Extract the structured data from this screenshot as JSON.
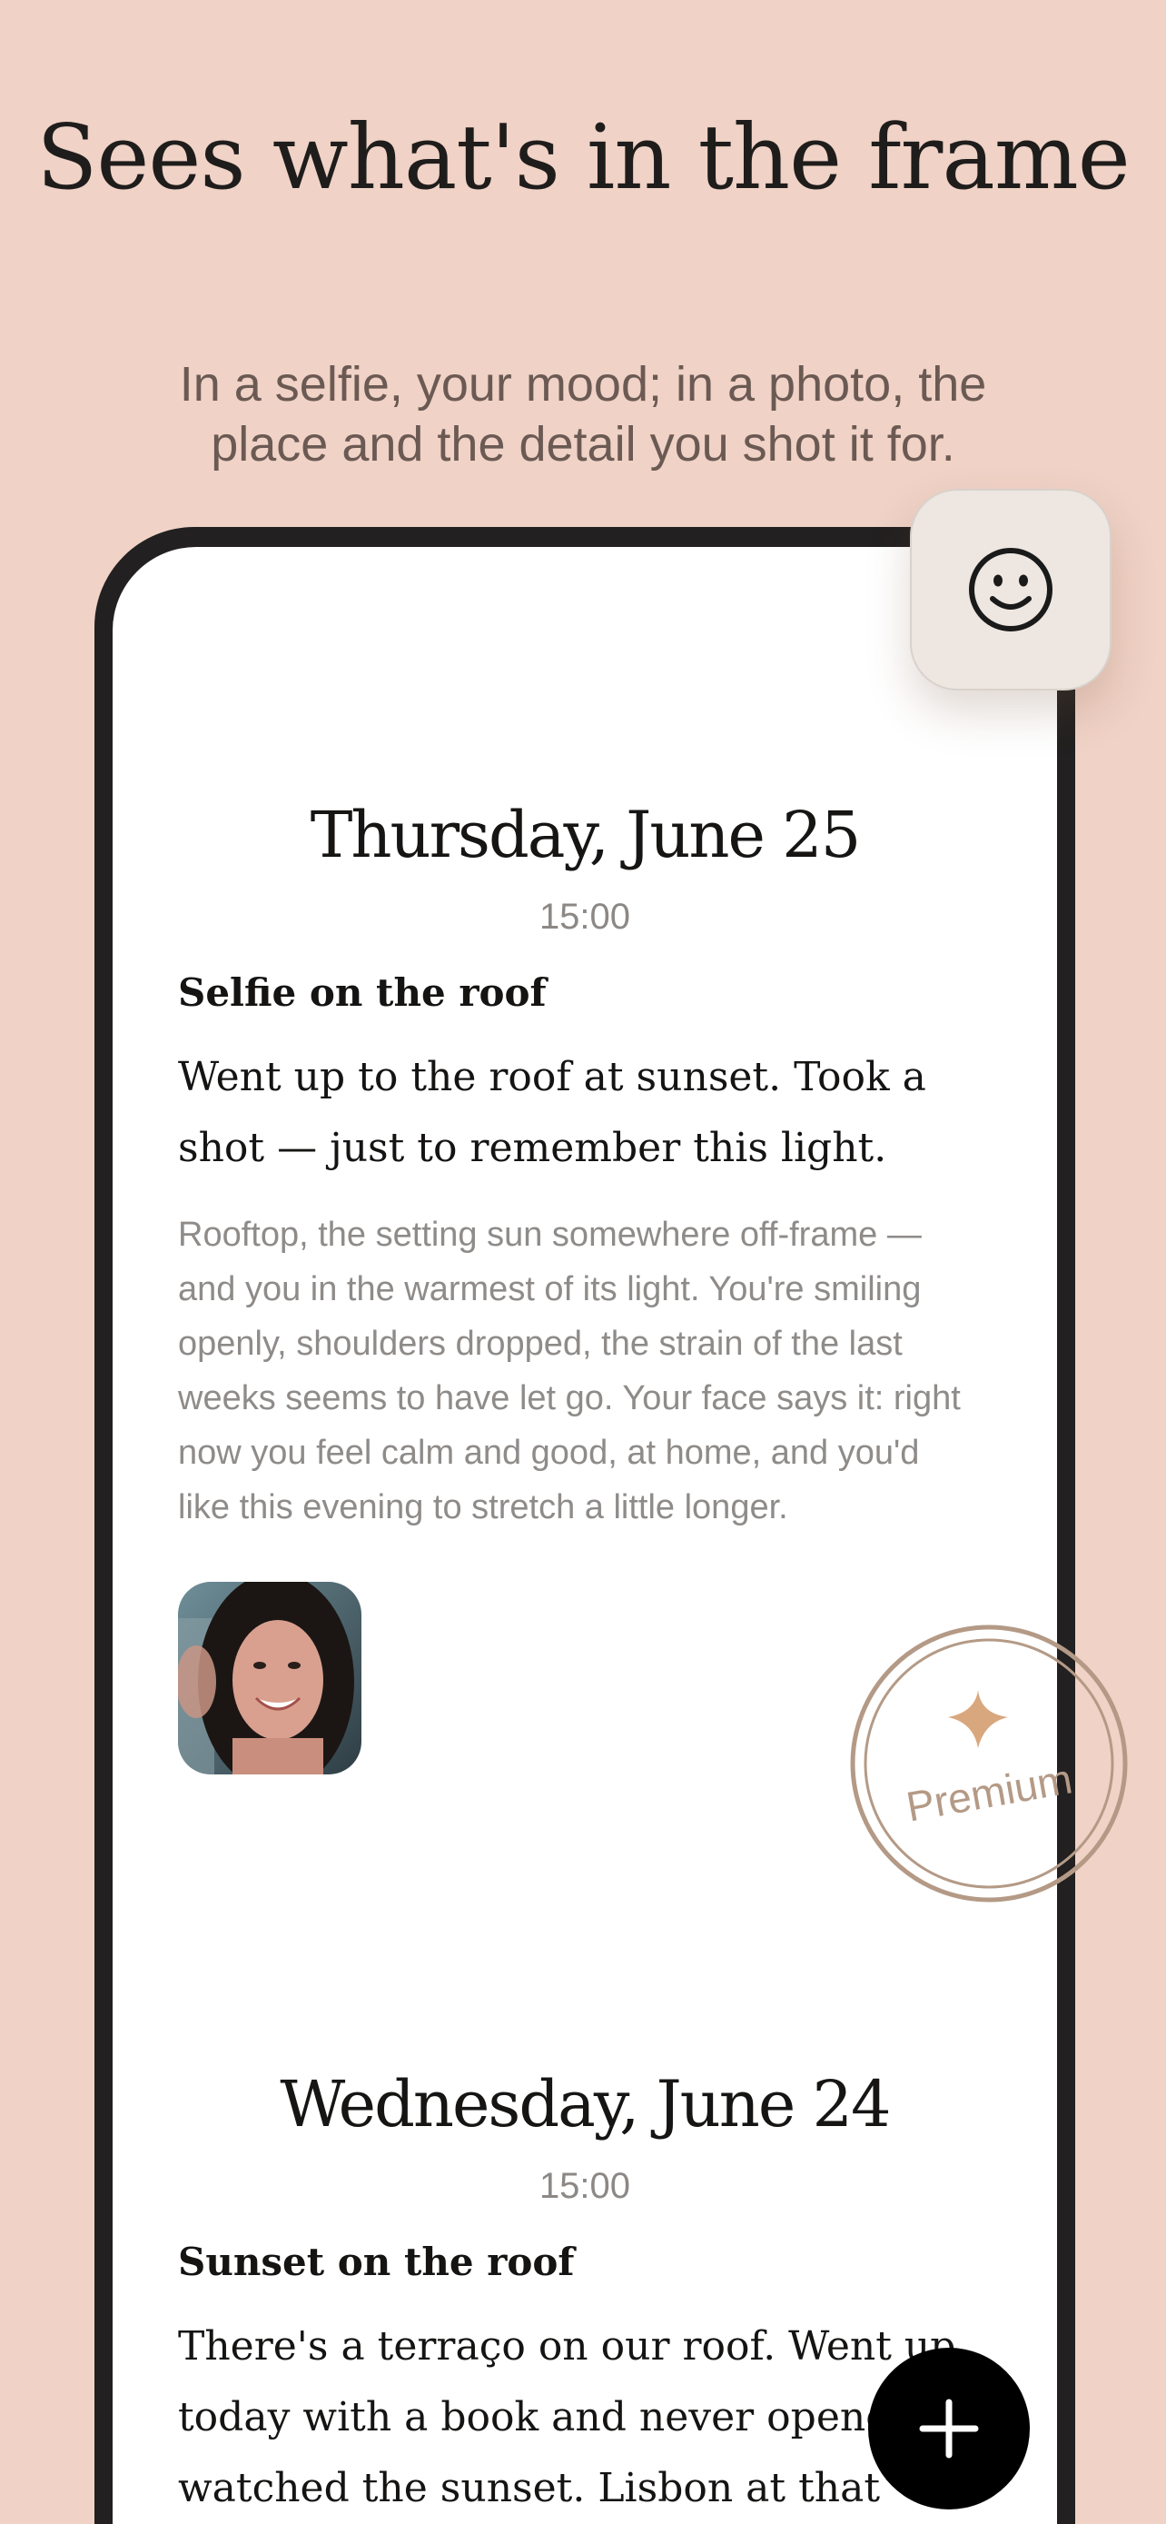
{
  "hero": {
    "title": "Sees what's in the frame",
    "subtitle": "In a selfie, your mood; in a photo, the place and the detail you shot it for."
  },
  "entries": [
    {
      "date": "Thursday, June 25",
      "time": "15:00",
      "title": "Selfie on the roof",
      "body": "Went up to the roof at sunset. Took a shot — just to remember this light.",
      "ai_reading": "Rooftop, the setting sun somewhere off-frame — and you in the warmest of its light. You're smiling openly, shoulders dropped, the strain of the last weeks seems to have let go. Your face says it: right now you feel calm and good, at home, and you'd like this evening to stretch a little longer."
    },
    {
      "date": "Wednesday, June 24",
      "time": "15:00",
      "title": "Sunset on the roof",
      "body": "There's a terraço on our roof. Went up today with a book and never opened it, watched the sunset. Lisbon at that hour is"
    }
  ],
  "premium_badge": {
    "label": "Premium",
    "icon": "sparkle-icon"
  },
  "mood_button": {
    "icon": "smiley-face-icon"
  },
  "fab": {
    "icon": "plus-icon"
  },
  "colors": {
    "background": "#F0D2C6",
    "phone_frame": "#222020",
    "stamp": "#B49A86",
    "sparkle": "#D9A77E",
    "fab": "#000000"
  }
}
